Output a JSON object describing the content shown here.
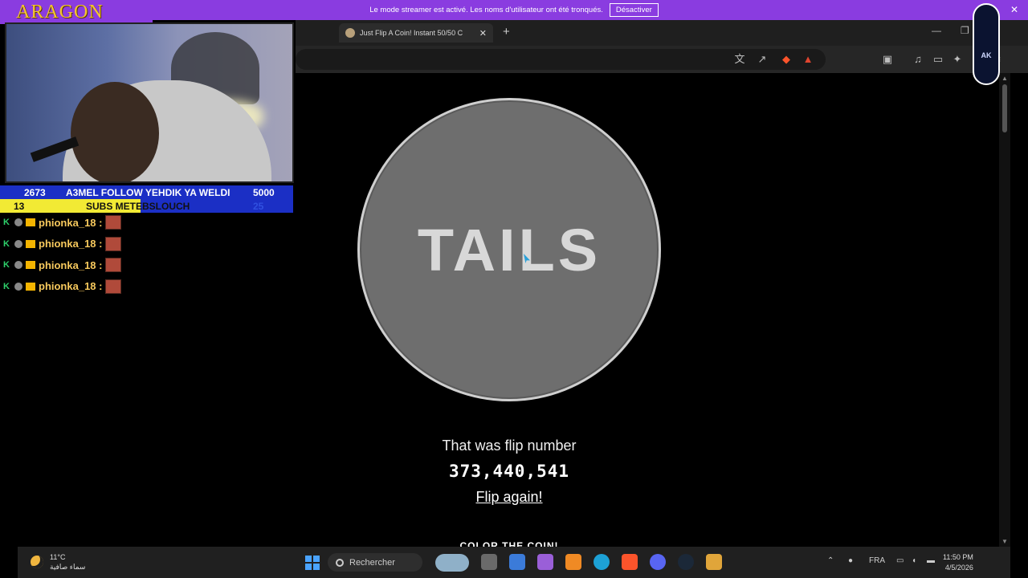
{
  "streamer_banner": {
    "message": "Le mode streamer est activé. Les noms d'utilisateur ont été tronqués.",
    "button_label": "Désactiver",
    "close": "✕"
  },
  "browser": {
    "tab_title": "Just Flip A Coin! Instant 50/50 C",
    "tab_close": "✕",
    "new_tab": "+",
    "minimize": "—",
    "restore": "❐"
  },
  "page": {
    "coin_result": "TAILS",
    "flip_caption": "That was flip number",
    "flip_number": "373,440,541",
    "flip_again": "Flip again!",
    "color_heading": "COLOR THE COIN!"
  },
  "overlay": {
    "logo": "ARAGON",
    "stats": {
      "left_count": "2673",
      "banner": "A3MEL FOLLOW YEHDIK YA WELDI",
      "goal": "5000",
      "subs_count": "13",
      "subs_label": "SUBS METEBSLOUCH",
      "subs_goal": "25"
    },
    "chat": [
      {
        "user": "phionka_18 :"
      },
      {
        "user": "phionka_18 :"
      },
      {
        "user": "phionka_18 :"
      },
      {
        "user": "phionka_18 :"
      }
    ]
  },
  "taskbar": {
    "temperature": "11°C",
    "weather_text": "سماء صافية",
    "search_placeholder": "Rechercher",
    "language": "FRA",
    "time": "11:50 PM",
    "date": "4/5/2026"
  },
  "colors": {
    "banner": "#8a3ce0",
    "coin": "#6e6e6e",
    "stats_blue": "#1b2fc5",
    "stats_yellow": "#f2ea34",
    "chat_user": "#f7c95d"
  }
}
